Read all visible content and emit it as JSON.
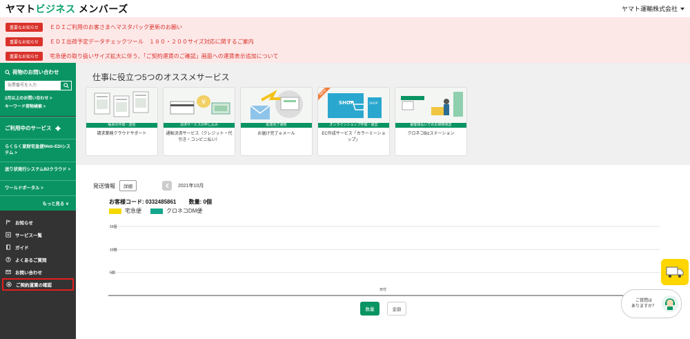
{
  "header": {
    "logo_main": "ヤマト",
    "logo_accent": "ビジネス",
    "logo_tail": "メンバーズ",
    "company": "ヤマト運輸株式会社"
  },
  "notices": [
    {
      "badge": "重要なお知らせ",
      "text": "ＥＤＩご利用のお客さまへマスタパック更新のお願い"
    },
    {
      "badge": "重要なお知らせ",
      "text": "ＥＤＩ出荷予定データチェックツール　１８０・２００サイズ対応に関するご案内"
    },
    {
      "badge": "重要なお知らせ",
      "text": "宅急便の取り扱いサイズ拡大に伴う、「ご契約運賃のご確認」画面への運賃表示追加について"
    }
  ],
  "sidebar": {
    "inquiry_title": "荷物のお問い合わせ",
    "search_placeholder": "伝票番号を入力",
    "link_two_months": "2月以上のお問い合わせ >",
    "link_keyword": "キーワード荷物検索 >",
    "services_title": "ご利用中のサービス",
    "services": [
      "らくらく家財宅急便Web-EDIシステム >",
      "送り状発行システムB2クラウド >",
      "ワールドポータル >"
    ],
    "more": "もっと見る ∨",
    "nav": [
      {
        "label": "お知らせ",
        "icon": "flag-icon"
      },
      {
        "label": "サービス一覧",
        "icon": "list-icon"
      },
      {
        "label": "ガイド",
        "icon": "book-icon"
      },
      {
        "label": "よくあるご質問",
        "icon": "question-icon"
      },
      {
        "label": "お問い合わせ",
        "icon": "mail-icon"
      },
      {
        "label": "ご契約運賃の確認",
        "icon": "yen-icon"
      }
    ]
  },
  "recommend": {
    "title": "仕事に役立つ5つのオススメサービス",
    "cards": [
      {
        "caption": "帳票の作成・送信",
        "label": "請求業務クラウドサポート"
      },
      {
        "caption": "決済サービスの申し込み",
        "label": "通販決済サービス（クレジット・代引き・コンビニ払い）"
      },
      {
        "caption": "配達完了通知",
        "label": "お届け完了ｅメール"
      },
      {
        "caption": "オンラインショップ作成・運営",
        "label": "EC作成サービス「カラーミーショップ」",
        "ribbon": "NEW"
      },
      {
        "caption": "顧客後払いでのお荷物発送",
        "label": "クロネコBizステーション"
      }
    ]
  },
  "shipment": {
    "title": "発送情報",
    "detail": "詳細",
    "month": "2021年10月",
    "customer_label": "お客様コード: 0332485861",
    "quantity_label": "数量: 0個",
    "toggle_quantity": "数量",
    "toggle_amount": "金額"
  },
  "chart_data": {
    "type": "bar",
    "categories": [],
    "series": [
      {
        "name": "宅急便",
        "values": [],
        "color": "#f5d800"
      },
      {
        "name": "クロネコDM便",
        "values": [],
        "color": "#13a68c"
      }
    ],
    "yticks": [
      "15個",
      "10個",
      "5個"
    ],
    "ylim": [
      0,
      15
    ],
    "xlabel": "日付",
    "grid": true,
    "legend": "top-left"
  },
  "help": {
    "text_line1": "ご質問は",
    "text_line2": "ありますか？"
  },
  "colors": {
    "brand_green": "#0a9463",
    "notice_red": "#d9322b",
    "notice_bg": "#fde8e8",
    "sidebar_dark": "#333333"
  }
}
